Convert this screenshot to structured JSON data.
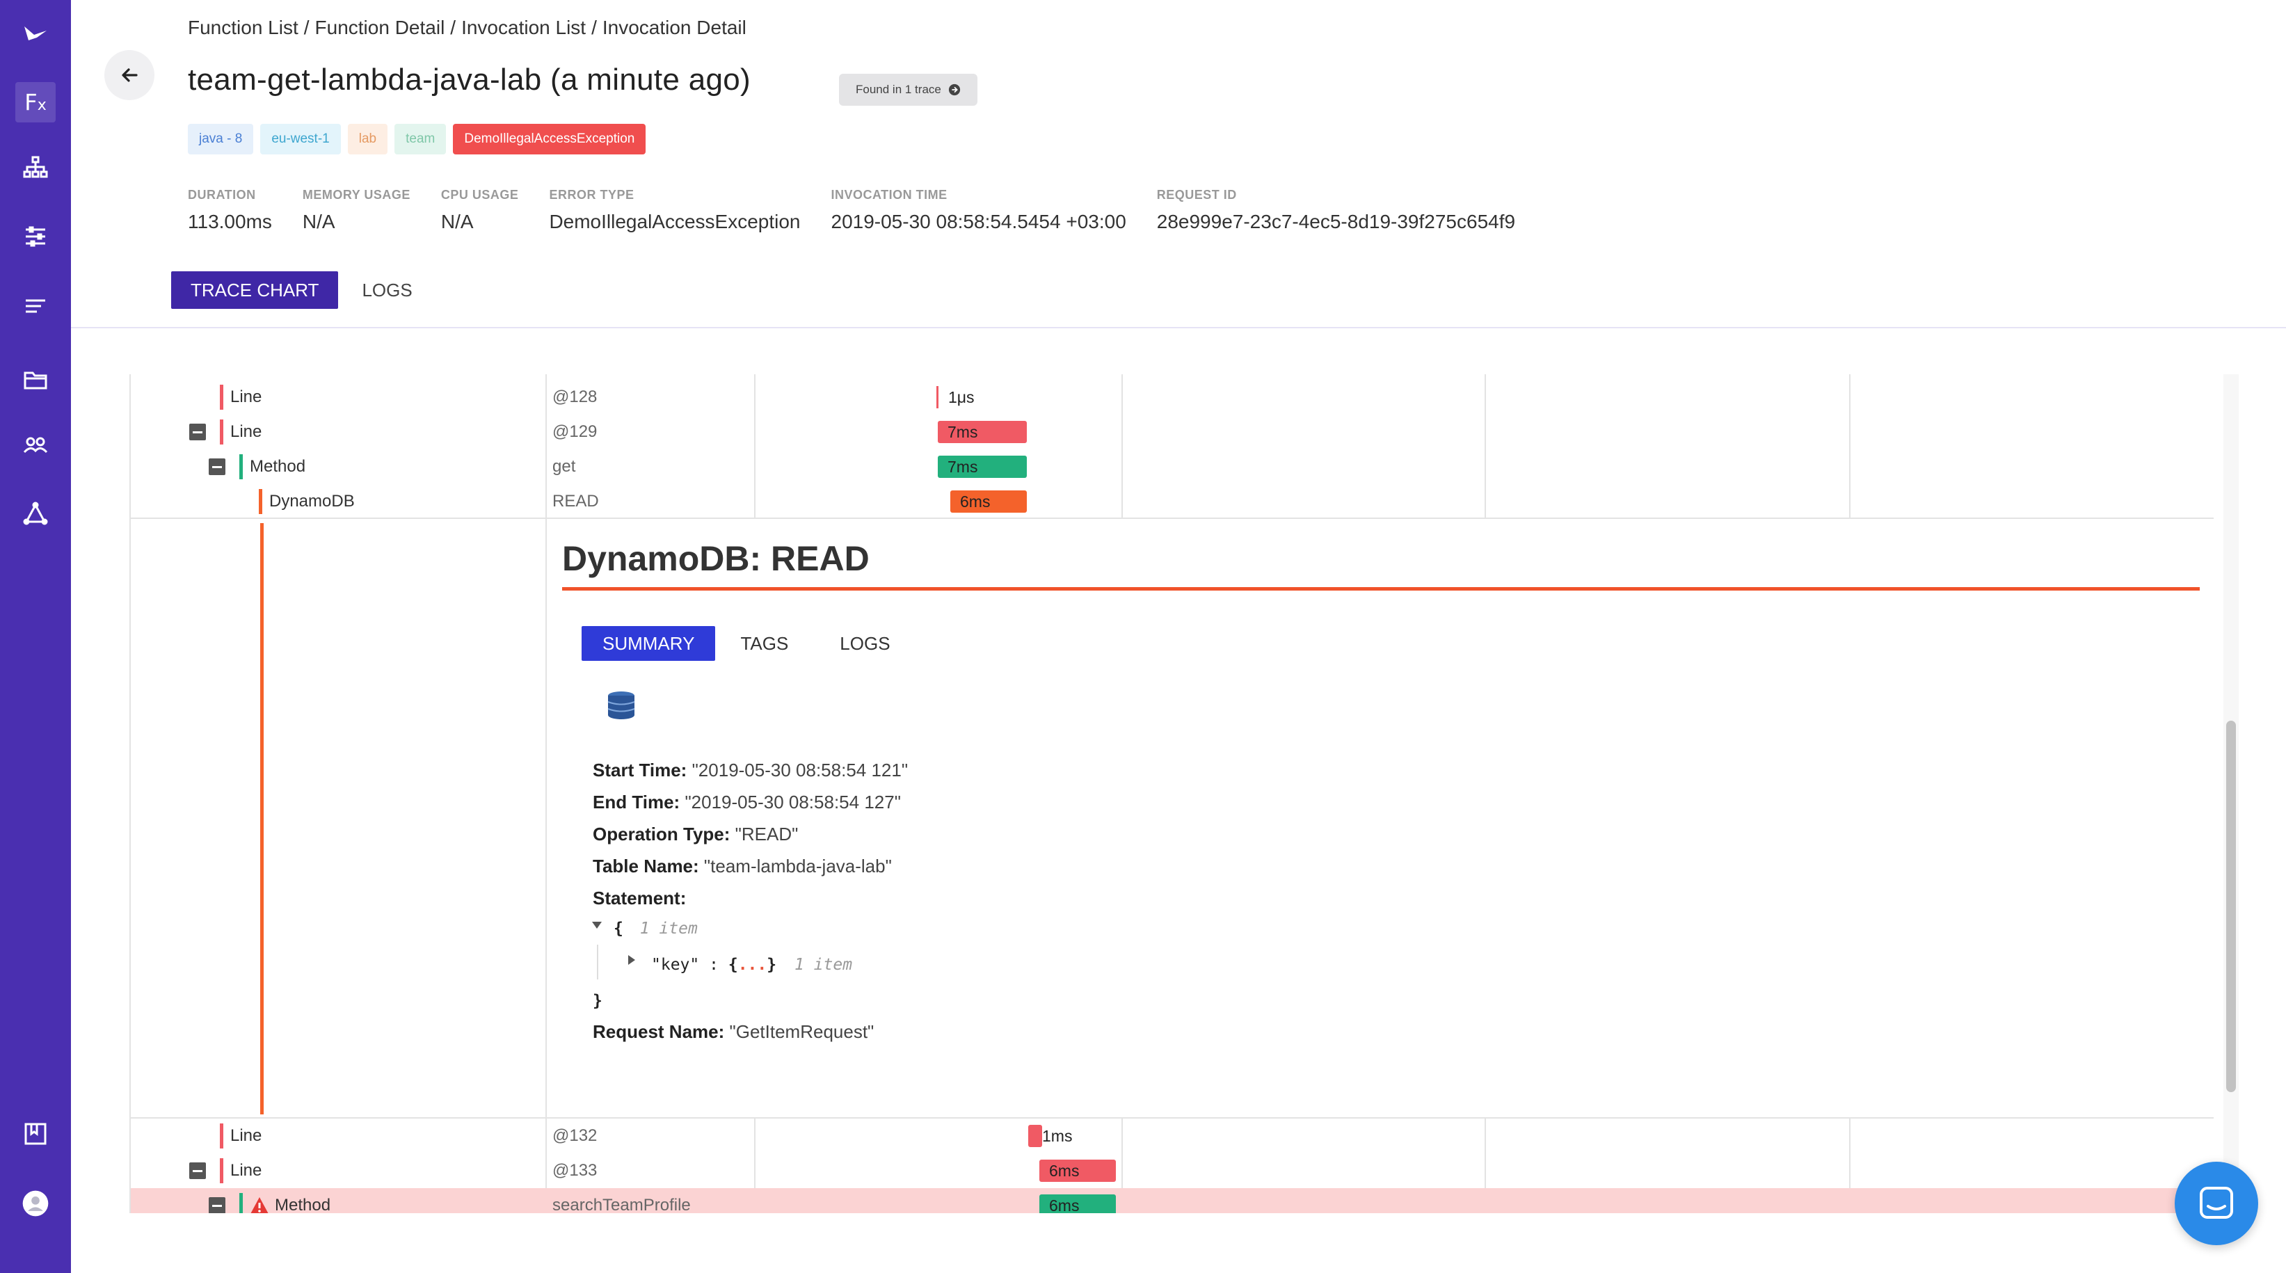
{
  "breadcrumb": [
    "Function List",
    "Function Detail",
    "Invocation List",
    "Invocation Detail"
  ],
  "title": "team-get-lambda-java-lab (a minute ago)",
  "found_badge": "Found in 1 trace",
  "tags": [
    {
      "label": "java - 8",
      "bg": "#e6f0fb",
      "fg": "#4a7fd4"
    },
    {
      "label": "eu-west-1",
      "bg": "#e3f4fb",
      "fg": "#3da6cf"
    },
    {
      "label": "lab",
      "bg": "#fdeee3",
      "fg": "#e59a62"
    },
    {
      "label": "team",
      "bg": "#e3f5ee",
      "fg": "#7fc7a8"
    },
    {
      "label": "DemoIllegalAccessException",
      "bg": "#f04e4e",
      "fg": "#ffffff"
    }
  ],
  "stats": [
    {
      "label": "DURATION",
      "value": "113.00ms"
    },
    {
      "label": "MEMORY USAGE",
      "value": "N/A"
    },
    {
      "label": "CPU USAGE",
      "value": "N/A"
    },
    {
      "label": "ERROR TYPE",
      "value": "DemoIllegalAccessException"
    },
    {
      "label": "INVOCATION TIME",
      "value": "2019-05-30 08:58:54.5454 +03:00"
    },
    {
      "label": "REQUEST ID",
      "value": "28e999e7-23c7-4ec5-8d19-39f275c654f9"
    }
  ],
  "tabs": {
    "trace_chart": "TRACE CHART",
    "logs": "LOGS"
  },
  "trace_rows_top": [
    {
      "name": "Line",
      "meta": "@128",
      "duration": "1μs"
    },
    {
      "name": "Line",
      "meta": "@129",
      "duration": "7ms"
    },
    {
      "name": "Method",
      "meta": "get",
      "duration": "7ms"
    },
    {
      "name": "DynamoDB",
      "meta": "READ",
      "duration": "6ms"
    }
  ],
  "detail": {
    "title": "DynamoDB: READ",
    "tabs": {
      "summary": "SUMMARY",
      "tags": "TAGS",
      "logs": "LOGS"
    },
    "start_time_label": "Start Time:",
    "start_time": "\"2019-05-30 08:58:54 121\"",
    "end_time_label": "End Time:",
    "end_time": "\"2019-05-30 08:58:54 127\"",
    "operation_type_label": "Operation Type:",
    "operation_type": "\"READ\"",
    "table_name_label": "Table Name:",
    "table_name": "\"team-lambda-java-lab\"",
    "statement_label": "Statement:",
    "json_open": "{",
    "json_count": "1 item",
    "json_key": "\"key\"",
    "json_colon": ":",
    "json_inner_open": "{",
    "json_inner_close": "}",
    "json_inner_count": "1 item",
    "json_close": "}",
    "request_name_label": "Request Name:",
    "request_name": "\"GetItemRequest\""
  },
  "trace_rows_bottom": [
    {
      "name": "Line",
      "meta": "@132",
      "duration": "1ms"
    },
    {
      "name": "Line",
      "meta": "@133",
      "duration": "6ms"
    },
    {
      "name": "Method",
      "meta": "searchTeamProfile",
      "duration": "6ms"
    }
  ],
  "colors": {
    "sidebar": "#4a2fb0",
    "line_red": "#f05a64",
    "method_green": "#22b07d",
    "dynamo_orange": "#f4622b",
    "error_row": "#fbd3d3"
  },
  "icons": [
    "logo-bird-icon",
    "function-icon",
    "hierarchy-icon",
    "filters-icon",
    "list-icon",
    "folder-icon",
    "team-icon",
    "integrations-icon",
    "docs-icon",
    "user-avatar-icon",
    "back-arrow-icon",
    "database-icon",
    "chat-icon",
    "warning-icon"
  ]
}
